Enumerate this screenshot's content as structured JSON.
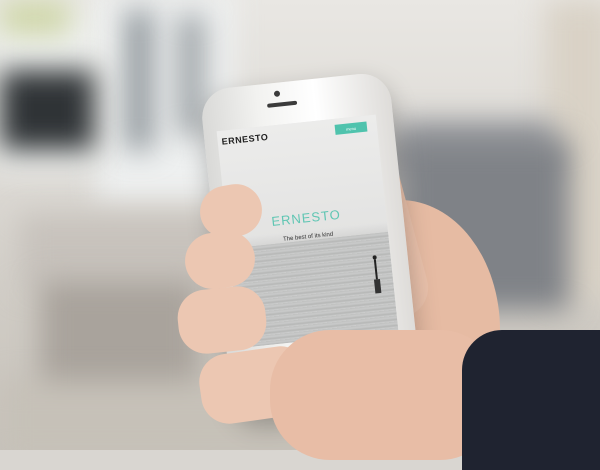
{
  "phone_screen": {
    "brand": "ERNESTO",
    "menu_button": "menu",
    "hero_title": "ERNESTO",
    "hero_subtitle": "The best of its kind"
  },
  "colors": {
    "accent": "#5fc6b3",
    "phone_body": "#f2f2f0",
    "sleeve": "#1f2330"
  },
  "icons": [
    "home-button-icon",
    "camera-icon",
    "speaker-icon"
  ]
}
